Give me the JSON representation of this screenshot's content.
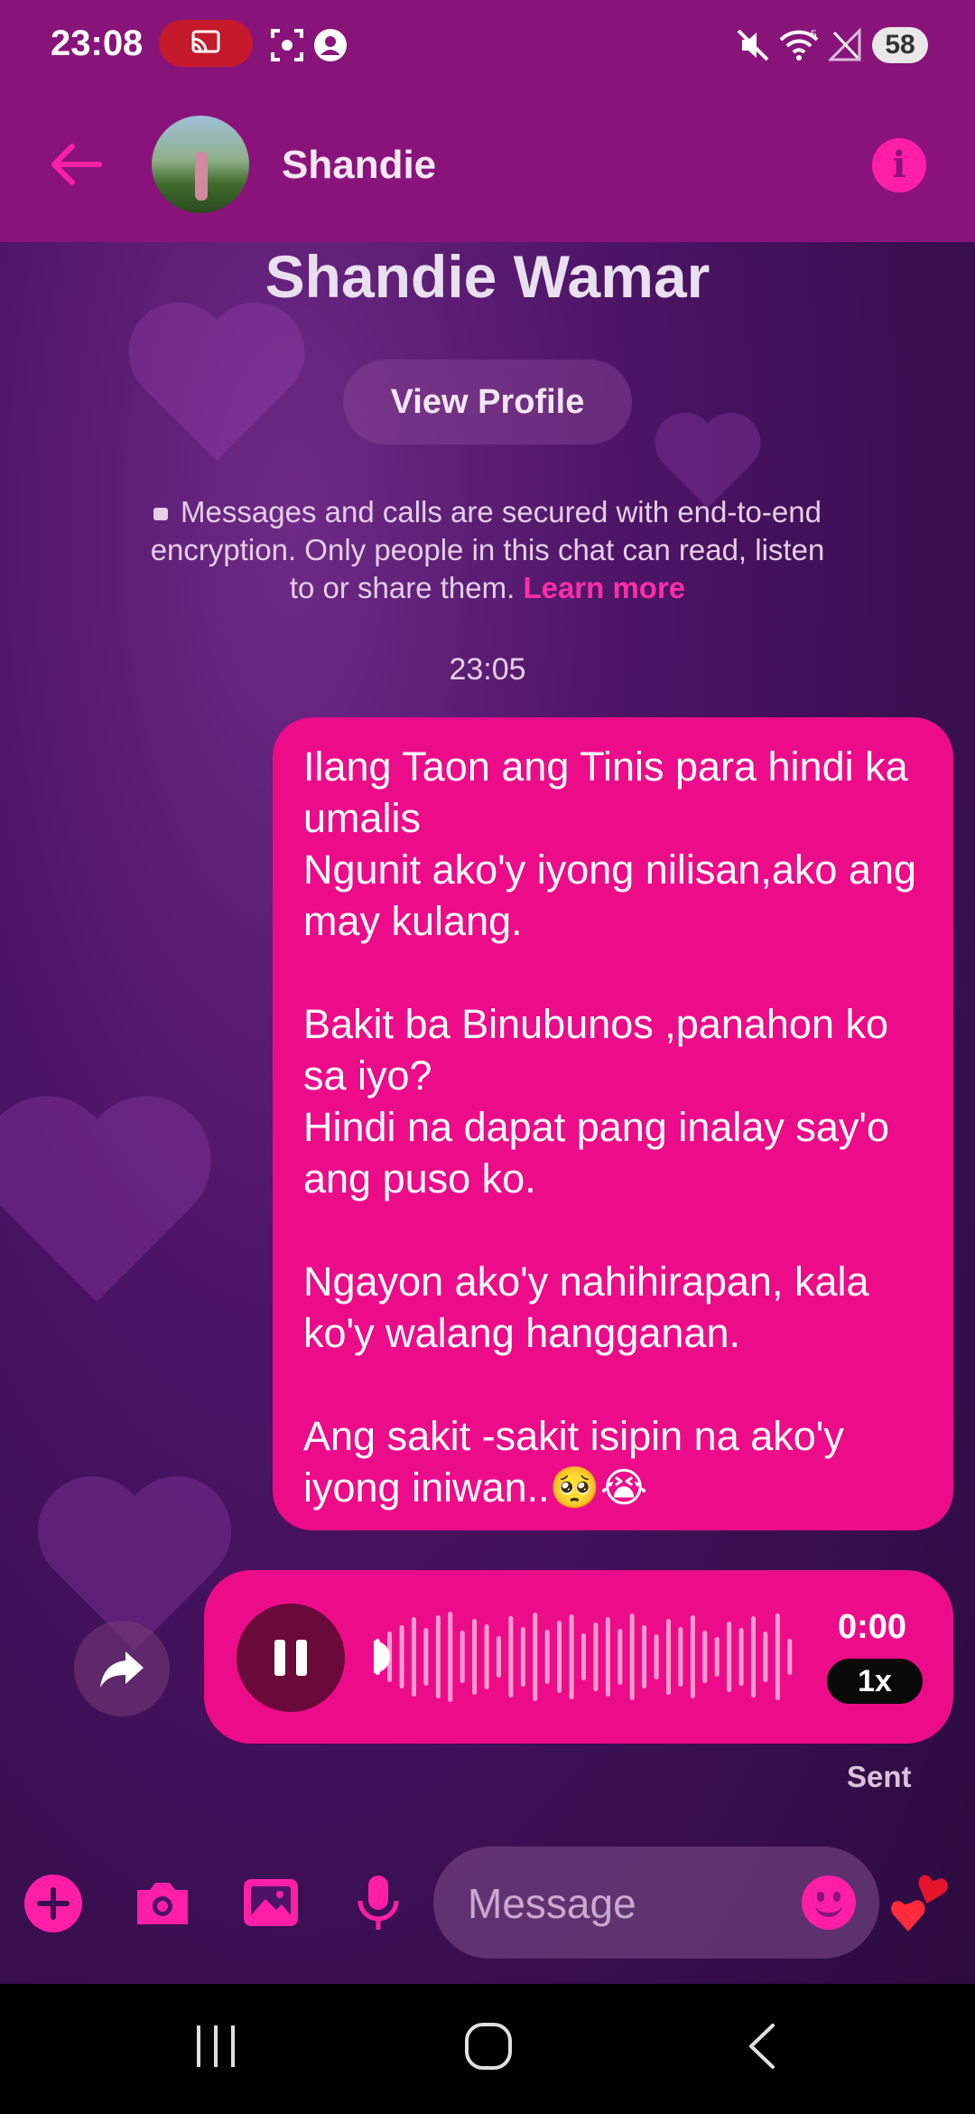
{
  "status_bar": {
    "time": "23:08",
    "battery": "58",
    "wifi_badge": "5"
  },
  "header": {
    "contact_name": "Shandie",
    "info_label": "i"
  },
  "profile": {
    "full_name": "Shandie Wamar",
    "view_profile_label": "View Profile"
  },
  "encryption_notice": {
    "text": "Messages and calls are secured with end-to-end encryption. Only people in this chat can read, listen to or share them.",
    "link_label": "Learn more"
  },
  "thread": {
    "timestamp": "23:05",
    "message_text": "Ilang Taon ang Tinis para hindi ka umalis\nNgunit ako'y iyong nilisan,ako ang may kulang.\n\nBakit ba Binubunos ,panahon ko sa iyo?\nHindi na dapat pang inalay say'o ang puso ko.\n\nNgayon ako'y nahihirapan, kala ko'y walang hangganan.\n\nAng sakit -sakit isipin na ako'y iyong iniwan..🥺😭",
    "voice_message": {
      "duration": "0:00",
      "speed": "1x",
      "progress": 0
    },
    "status": "Sent"
  },
  "composer": {
    "placeholder": "Message",
    "icons": [
      "plus-icon",
      "camera-icon",
      "gallery-icon",
      "microphone-icon",
      "emoji-icon",
      "heart-reaction-icon"
    ]
  },
  "nav": {
    "icons": [
      "recents-icon",
      "home-icon",
      "back-icon"
    ]
  },
  "colors": {
    "accent": "#ff1fa7",
    "bubble": "#ec0c8a",
    "header": "#8a137b",
    "background": "#4d1466"
  }
}
